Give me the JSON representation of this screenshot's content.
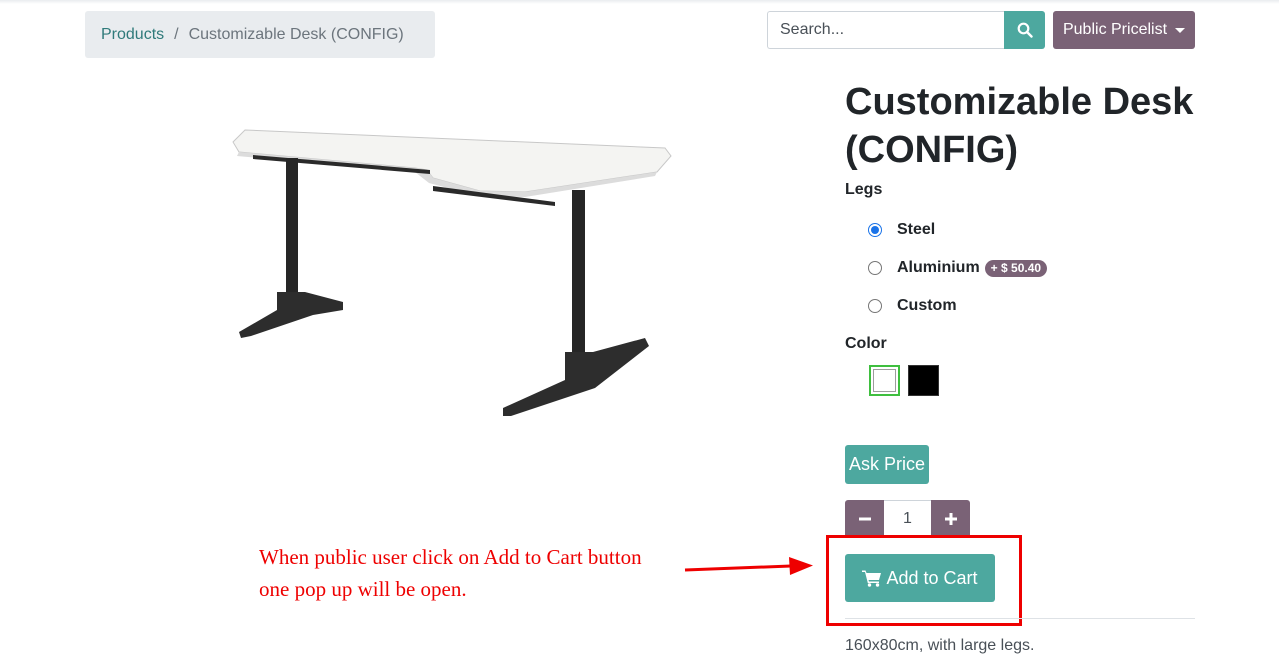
{
  "breadcrumb": {
    "parent": "Products",
    "separator": "/",
    "current": "Customizable Desk (CONFIG)"
  },
  "search": {
    "placeholder": "Search...",
    "icon": "search-icon"
  },
  "pricelist": {
    "label": "Public Pricelist"
  },
  "product": {
    "title": "Customizable Desk (CONFIG)",
    "image": "desk-image",
    "description": "160x80cm, with large legs."
  },
  "legs": {
    "label": "Legs",
    "options": [
      {
        "label": "Steel",
        "checked": true
      },
      {
        "label": "Aluminium",
        "extra": "+ $ 50.40",
        "checked": false
      },
      {
        "label": "Custom",
        "checked": false
      }
    ]
  },
  "color": {
    "label": "Color",
    "options": [
      {
        "name": "white",
        "hex": "#ffffff",
        "selected": true
      },
      {
        "name": "black",
        "hex": "#000000",
        "selected": false
      }
    ]
  },
  "actions": {
    "ask_price": "Ask Price",
    "quantity": "1",
    "add_to_cart": "Add to Cart",
    "cart_icon": "shopping-cart-icon"
  },
  "annotation": {
    "line1": "When public user click on Add to Cart button",
    "line2": "one pop up will be open."
  },
  "colors": {
    "accent": "#4da89f",
    "secondary": "#7a6276",
    "annotation": "#ee0000"
  }
}
